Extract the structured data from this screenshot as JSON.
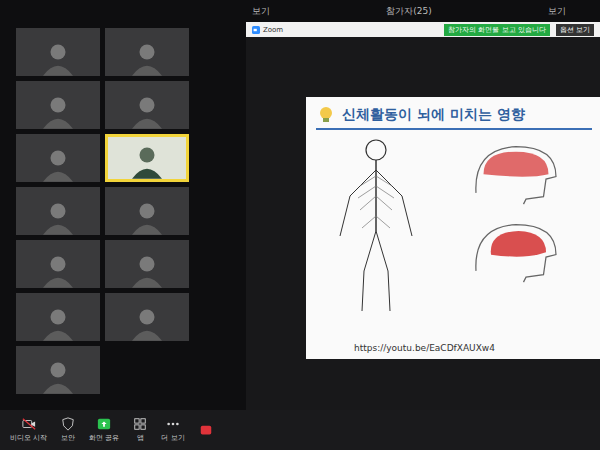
{
  "top_bar": {
    "left_view": "보기",
    "participants": "참가자(25)",
    "right_view": "보기"
  },
  "share_header": {
    "app": "Zoom",
    "banner": "참가자의 화면을 보고 있습니다",
    "options": "옵션 보기"
  },
  "gallery": [
    {
      "kind": "camera",
      "highlighted": false
    },
    {
      "kind": "camera",
      "highlighted": false
    },
    {
      "kind": "camera",
      "highlighted": false
    },
    {
      "kind": "camera",
      "highlighted": false
    },
    {
      "kind": "camera",
      "highlighted": false
    },
    {
      "kind": "presenter",
      "highlighted": true
    },
    {
      "kind": "camera",
      "highlighted": false
    },
    {
      "kind": "camera",
      "highlighted": false
    },
    {
      "kind": "camera",
      "highlighted": false
    },
    {
      "kind": "camera",
      "highlighted": false
    },
    {
      "kind": "camera",
      "highlighted": false
    },
    {
      "kind": "camera",
      "highlighted": false
    },
    {
      "kind": "camera",
      "highlighted": false
    }
  ],
  "slide": {
    "title": "신체활동이 뇌에 미치는 영향",
    "link": "https://youtu.be/EaCDfXAUXw4"
  },
  "toolbar": [
    {
      "label": "비디오 시작",
      "kind": "video",
      "color": "#d8d8d8"
    },
    {
      "label": "보안",
      "kind": "shield",
      "color": "#d8d8d8"
    },
    {
      "label": "화면 공유",
      "kind": "share",
      "color": "#2bc24f"
    },
    {
      "label": "앱",
      "kind": "apps",
      "color": "#d8d8d8"
    },
    {
      "label": "더 보기",
      "kind": "more",
      "color": "#d8d8d8"
    },
    {
      "label": "",
      "kind": "end",
      "color": "#e0333a"
    }
  ]
}
